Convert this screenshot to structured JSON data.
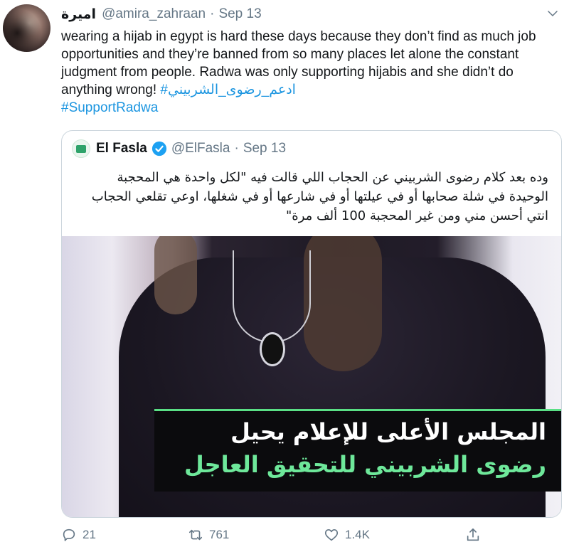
{
  "tweet": {
    "display_name": "اميرة",
    "handle": "@amira_zahraan",
    "separator": "·",
    "date": "Sep 13",
    "text_part1": "wearing a hijab in egypt is hard these days because they don’t find as much job opportunities and they’re banned from so many places let alone the constant judgment from people. Radwa was only supporting hijabis and she didn’t do anything wrong! ",
    "hashtag_1": "#ادعم_رضوى_الشربيني",
    "hashtag_2": "#SupportRadwa"
  },
  "quoted_tweet": {
    "display_name": "El Fasla",
    "handle": "@ElFasla",
    "separator": "·",
    "date": "Sep 13",
    "text": "وده بعد كلام رضوى الشربيني عن الحجاب اللي قالت فيه \"لكل واحدة هي المحجبة الوحيدة في شلة صحابها أو في عيلتها أو في شارعها أو في شغلها، اوعي تقلعي الحجاب انتي أحسن مني ومن غير المحجبة 100 ألف مرة\"",
    "media": {
      "caption_line1": "المجلس الأعلى للإعلام يحيل",
      "caption_line2": "رضوى الشربيني للتحقيق العاجل"
    }
  },
  "actions": {
    "reply_count": "21",
    "retweet_count": "761",
    "like_count": "1.4K"
  },
  "colors": {
    "link": "#1b95e0",
    "muted": "#657786",
    "border": "#ccd6dd",
    "verified": "#1da1f2",
    "caption_accent": "#6ee89a"
  },
  "icons": [
    "caret-down-icon",
    "verified-badge-icon",
    "reply-icon",
    "retweet-icon",
    "like-icon",
    "share-icon"
  ]
}
